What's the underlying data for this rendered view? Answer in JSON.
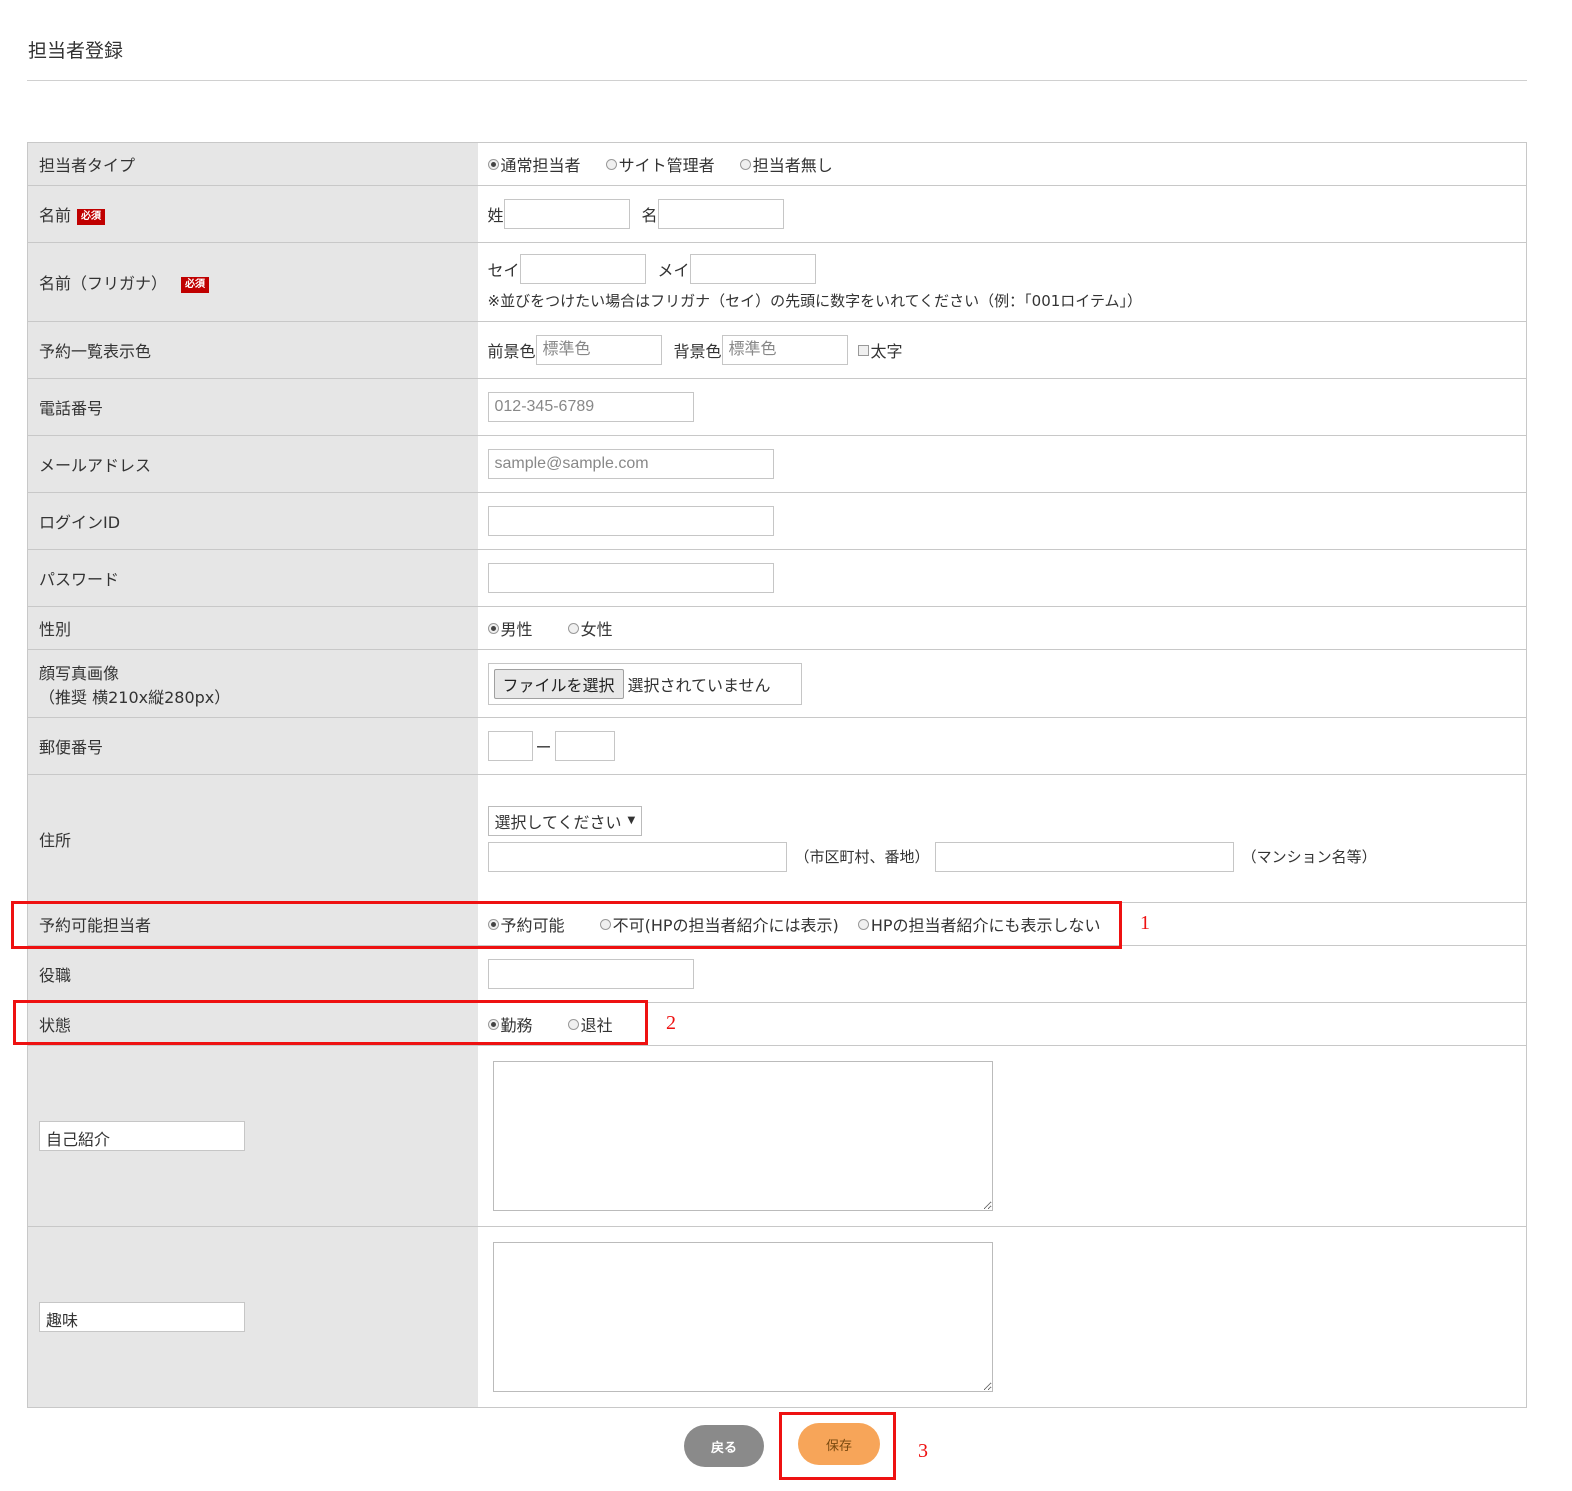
{
  "page_title": "担当者登録",
  "staff_type": {
    "label": "担当者タイプ",
    "options": [
      "通常担当者",
      "サイト管理者",
      "担当者無し"
    ],
    "selected": 0
  },
  "name": {
    "label": "名前",
    "required": "必須",
    "last_label": "姓",
    "first_label": "名"
  },
  "kana": {
    "label": "名前（フリガナ）",
    "required": "必須",
    "last_label": "セイ",
    "first_label": "メイ",
    "note": "※並びをつけたい場合はフリガナ（セイ）の先頭に数字をいれてください（例：「001ロイテム」）"
  },
  "color": {
    "label": "予約一覧表示色",
    "fg_label": "前景色",
    "fg_placeholder": "標準色",
    "bg_label": "背景色",
    "bg_placeholder": "標準色",
    "bold_label": "太字"
  },
  "phone": {
    "label": "電話番号",
    "placeholder": "012-345-6789"
  },
  "email": {
    "label": "メールアドレス",
    "placeholder": "sample@sample.com"
  },
  "login_id": {
    "label": "ログインID"
  },
  "password": {
    "label": "パスワード"
  },
  "gender": {
    "label": "性別",
    "options": [
      "男性",
      "女性"
    ],
    "selected": 0
  },
  "photo": {
    "label": "顔写真画像",
    "hint": "（推奨 横210x縦280px）",
    "button": "ファイルを選択",
    "status": "選択されていません"
  },
  "postal": {
    "label": "郵便番号",
    "separator": "ー"
  },
  "address": {
    "label": "住所",
    "select_value": "選択してください",
    "line1_note": "（市区町村、番地）",
    "line2_note": "（マンション名等）"
  },
  "bookable": {
    "label": "予約可能担当者",
    "options": [
      "予約可能",
      "不可(HPの担当者紹介には表示)",
      "HPの担当者紹介にも表示しない"
    ],
    "selected": 0
  },
  "position": {
    "label": "役職"
  },
  "status": {
    "label": "状態",
    "options": [
      "勤務",
      "退社"
    ],
    "selected": 0
  },
  "intro": {
    "label_value": "自己紹介"
  },
  "hobby": {
    "label_value": "趣味"
  },
  "buttons": {
    "back": "戻る",
    "save": "保存"
  },
  "annotations": [
    "1",
    "2",
    "3"
  ],
  "colors": {
    "highlight": "#ee1111",
    "required_badge": "#c00000",
    "save_button": "#f7a559",
    "back_button": "#8a8a8a"
  }
}
